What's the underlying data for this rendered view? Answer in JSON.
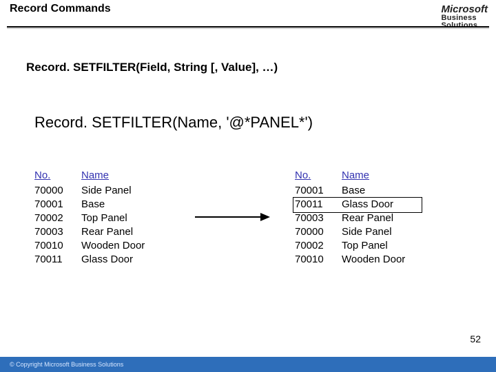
{
  "header": {
    "title": "Record Commands",
    "logo_line1": "Microsoft",
    "logo_line2": "Business",
    "logo_line3": "Solutions"
  },
  "signature": "Record. SETFILTER(Field, String [, Value], …)",
  "example": "Record. SETFILTER(Name, '@*PANEL*')",
  "left_table": {
    "no_header": "No.",
    "name_header": "Name",
    "rows": [
      {
        "no": "70000",
        "name": "Side Panel"
      },
      {
        "no": "70001",
        "name": "Base"
      },
      {
        "no": "70002",
        "name": "Top Panel"
      },
      {
        "no": "70003",
        "name": "Rear Panel"
      },
      {
        "no": "70010",
        "name": "Wooden Door"
      },
      {
        "no": "70011",
        "name": "Glass Door"
      }
    ]
  },
  "right_table": {
    "no_header": "No.",
    "name_header": "Name",
    "rows": [
      {
        "no": "70001",
        "name": "Base"
      },
      {
        "no": "70011",
        "name": "Glass Door"
      },
      {
        "no": "70003",
        "name": "Rear Panel"
      },
      {
        "no": "70000",
        "name": "Side Panel"
      },
      {
        "no": "70002",
        "name": "Top Panel"
      },
      {
        "no": "70010",
        "name": "Wooden Door"
      }
    ]
  },
  "page_number": "52",
  "footer": "© Copyright Microsoft Business Solutions"
}
